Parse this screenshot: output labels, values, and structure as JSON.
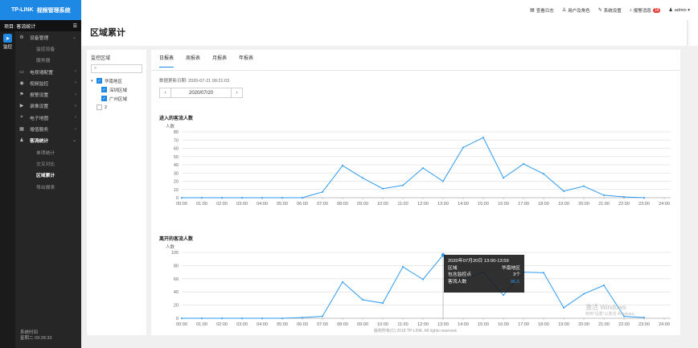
{
  "brand": {
    "logo": "TP-LINK",
    "title": "视频管理系统"
  },
  "project_bar": {
    "label": "项目: 客流统计",
    "menu_icon": "hamburger-icon"
  },
  "rail": {
    "items": [
      {
        "label": "监控",
        "icon": "send-icon"
      }
    ]
  },
  "nav": {
    "items": [
      {
        "label": "设备管理",
        "icon": "device-icon",
        "chev": "⌄",
        "type": "group"
      },
      {
        "label": "监控设备",
        "type": "sub"
      },
      {
        "label": "服务器",
        "type": "sub"
      },
      {
        "label": "电视墙配置",
        "icon": "tv-wall-icon",
        "chev": "›",
        "type": "group"
      },
      {
        "label": "视频监控",
        "icon": "video-icon",
        "chev": "›",
        "type": "group"
      },
      {
        "label": "报警设置",
        "icon": "alarm-icon",
        "chev": "›",
        "type": "group"
      },
      {
        "label": "录像设置",
        "icon": "record-icon",
        "chev": "›",
        "type": "group"
      },
      {
        "label": "电子地图",
        "icon": "map-pin-icon",
        "chev": "›",
        "type": "group"
      },
      {
        "label": "增值服务",
        "icon": "grid-icon",
        "chev": "›",
        "type": "group"
      },
      {
        "label": "客流统计",
        "icon": "people-icon",
        "chev": "⌄",
        "type": "bold"
      },
      {
        "label": "单项统计",
        "type": "sub"
      },
      {
        "label": "交叉对比",
        "type": "sub"
      },
      {
        "label": "区域累计",
        "type": "sub-active"
      },
      {
        "label": "导出报表",
        "type": "sub"
      }
    ],
    "system_time_label": "系统时间",
    "system_time_value": "星期二 09:28:33"
  },
  "topbar": {
    "items": [
      {
        "label": "查看日志",
        "icon": "log-icon"
      },
      {
        "label": "用户及角色",
        "icon": "user-role-icon"
      },
      {
        "label": "系统设置",
        "icon": "wrench-icon"
      },
      {
        "label": "报警消息",
        "icon": "bell-icon",
        "badge": "18"
      },
      {
        "label": "admin ▾",
        "icon": "user-icon"
      }
    ]
  },
  "page_title": "区域累计",
  "tree": {
    "title": "监控区域",
    "search_icon": "search-icon",
    "search_placeholder": "",
    "nodes": [
      {
        "label": "华南地区",
        "checked": true,
        "level": 0
      },
      {
        "label": "深圳区域",
        "checked": true,
        "level": 1
      },
      {
        "label": "广州区域",
        "checked": true,
        "level": 1
      },
      {
        "label": "2",
        "checked": false,
        "level": 0
      }
    ]
  },
  "tabs": [
    {
      "label": "日报表",
      "active": true
    },
    {
      "label": "周报表",
      "active": false
    },
    {
      "label": "月报表",
      "active": false
    },
    {
      "label": "年报表",
      "active": false
    }
  ],
  "update_text": "数据更新日期: 2020-07-21 09:21:03",
  "date_picker": {
    "value": "2020/07/20",
    "prev": "‹",
    "next": "›"
  },
  "accent_color": "#1e88e5",
  "line_color": "#2e9bf0",
  "chart_data": [
    {
      "type": "line",
      "title": "进入的客流人数",
      "ylabel": "人数",
      "ylim": [
        0,
        80
      ],
      "yticks": [
        0,
        10,
        20,
        30,
        40,
        50,
        60,
        70,
        80
      ],
      "categories": [
        "00:00",
        "01:00",
        "02:00",
        "03:00",
        "04:00",
        "05:00",
        "06:00",
        "07:00",
        "08:00",
        "09:00",
        "10:00",
        "11:00",
        "12:00",
        "13:00",
        "14:00",
        "15:00",
        "16:00",
        "17:00",
        "18:00",
        "19:00",
        "20:00",
        "21:00",
        "22:00",
        "23:00",
        "24:00"
      ],
      "values": [
        0,
        0,
        0,
        0,
        0,
        0,
        0,
        7,
        39,
        24,
        11,
        15,
        36,
        20,
        61,
        73,
        24,
        41,
        29,
        8,
        14,
        3,
        1,
        0,
        null
      ],
      "grid": true
    },
    {
      "type": "line",
      "title": "离开的客流人数",
      "ylabel": "人数",
      "ylim": [
        0,
        100
      ],
      "yticks": [
        0,
        20,
        40,
        60,
        80,
        100
      ],
      "categories": [
        "00:00",
        "01:00",
        "02:00",
        "03:00",
        "04:00",
        "05:00",
        "06:00",
        "07:00",
        "08:00",
        "09:00",
        "10:00",
        "11:00",
        "12:00",
        "13:00",
        "14:00",
        "15:00",
        "16:00",
        "17:00",
        "18:00",
        "19:00",
        "20:00",
        "21:00",
        "22:00",
        "23:00",
        "24:00"
      ],
      "values": [
        0,
        0,
        0,
        0,
        0,
        0,
        1,
        3,
        55,
        28,
        23,
        78,
        59,
        96,
        59,
        70,
        35,
        70,
        69,
        16,
        37,
        50,
        3,
        1,
        null
      ],
      "grid": true,
      "tooltip": {
        "title": "2020年07月20日 13:00-13:59",
        "rows": [
          {
            "key": "区域",
            "value": "华南地区"
          },
          {
            "key": "包含监控点",
            "value": "3个"
          },
          {
            "key": "客流人数",
            "value": "96人"
          }
        ]
      }
    }
  ],
  "footer": "版权所有(C) 2018 TP-LINK. All rights reserved.",
  "watermark": {
    "line1": "激活 Windows",
    "line2": "转到“设置”以激活 Windows。"
  }
}
